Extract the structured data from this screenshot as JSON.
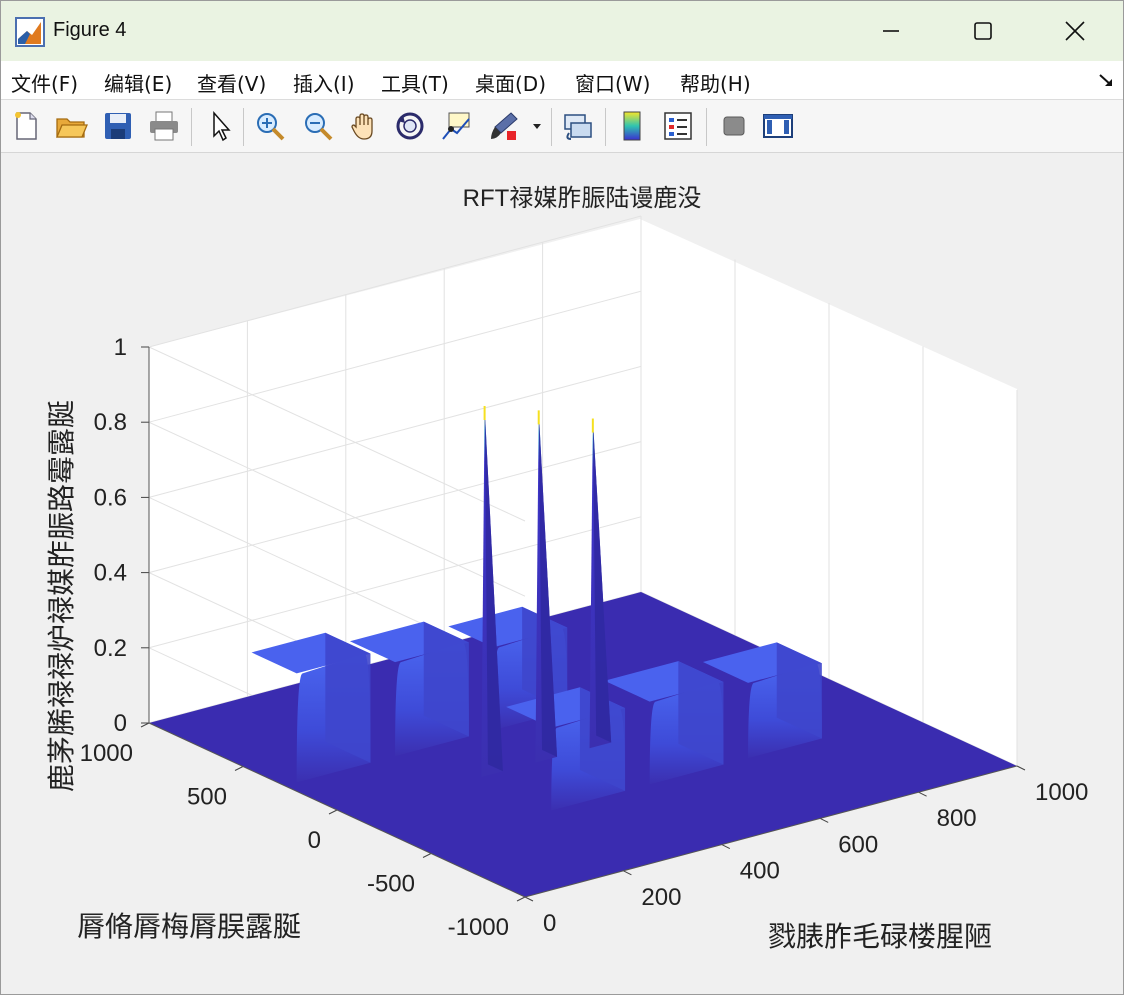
{
  "window": {
    "title": "Figure 4",
    "controls": {
      "minimize": "minimize",
      "maximize": "maximize",
      "close": "close"
    }
  },
  "menu": [
    {
      "label": "文件(F)"
    },
    {
      "label": "编辑(E)"
    },
    {
      "label": "查看(V)"
    },
    {
      "label": "插入(I)"
    },
    {
      "label": "工具(T)"
    },
    {
      "label": "桌面(D)"
    },
    {
      "label": "窗口(W)"
    },
    {
      "label": "帮助(H)"
    }
  ],
  "toolbar": [
    "new-file-icon",
    "open-folder-icon",
    "save-icon",
    "print-icon",
    "pointer-icon",
    "zoom-in-icon",
    "zoom-out-icon",
    "pan-hand-icon",
    "rotate-3d-icon",
    "data-cursor-icon",
    "brush-icon",
    "link-plot-icon",
    "colorbar-icon",
    "legend-icon",
    "hide-plot-tools-icon",
    "show-plot-tools-icon"
  ],
  "chart_data": {
    "type": "surface",
    "title": "RFT禄媒胙脤陆谩鹿没",
    "xlabel": "戮脿胙毛碌楼腥陋",
    "ylabel": "脣脩脣梅脣脵露脠",
    "zlabel": "鹿茅脪禄禄炉禄媒胙脤路霉露脠",
    "x_ticks": [
      0,
      200,
      400,
      600,
      800,
      1000
    ],
    "y_ticks": [
      -1000,
      -500,
      0,
      500,
      1000
    ],
    "z_ticks": [
      0,
      0.2,
      0.4,
      0.6,
      0.8,
      1
    ],
    "xlim": [
      0,
      1000
    ],
    "ylim": [
      -1000,
      1000
    ],
    "zlim": [
      0,
      1
    ],
    "colormap": "parula",
    "peaks": [
      {
        "x": 300,
        "y": 0,
        "z": 0.97
      },
      {
        "x": 410,
        "y": 0,
        "z": 0.92
      },
      {
        "x": 520,
        "y": 0,
        "z": 0.86
      }
    ],
    "plateaus": [
      {
        "x": 100,
        "y": 400,
        "z": 0.29
      },
      {
        "x": 300,
        "y": 400,
        "z": 0.25
      },
      {
        "x": 500,
        "y": 400,
        "z": 0.22
      },
      {
        "x": 350,
        "y": -300,
        "z": 0.22
      },
      {
        "x": 550,
        "y": -300,
        "z": 0.22
      },
      {
        "x": 750,
        "y": -300,
        "z": 0.2
      }
    ]
  }
}
